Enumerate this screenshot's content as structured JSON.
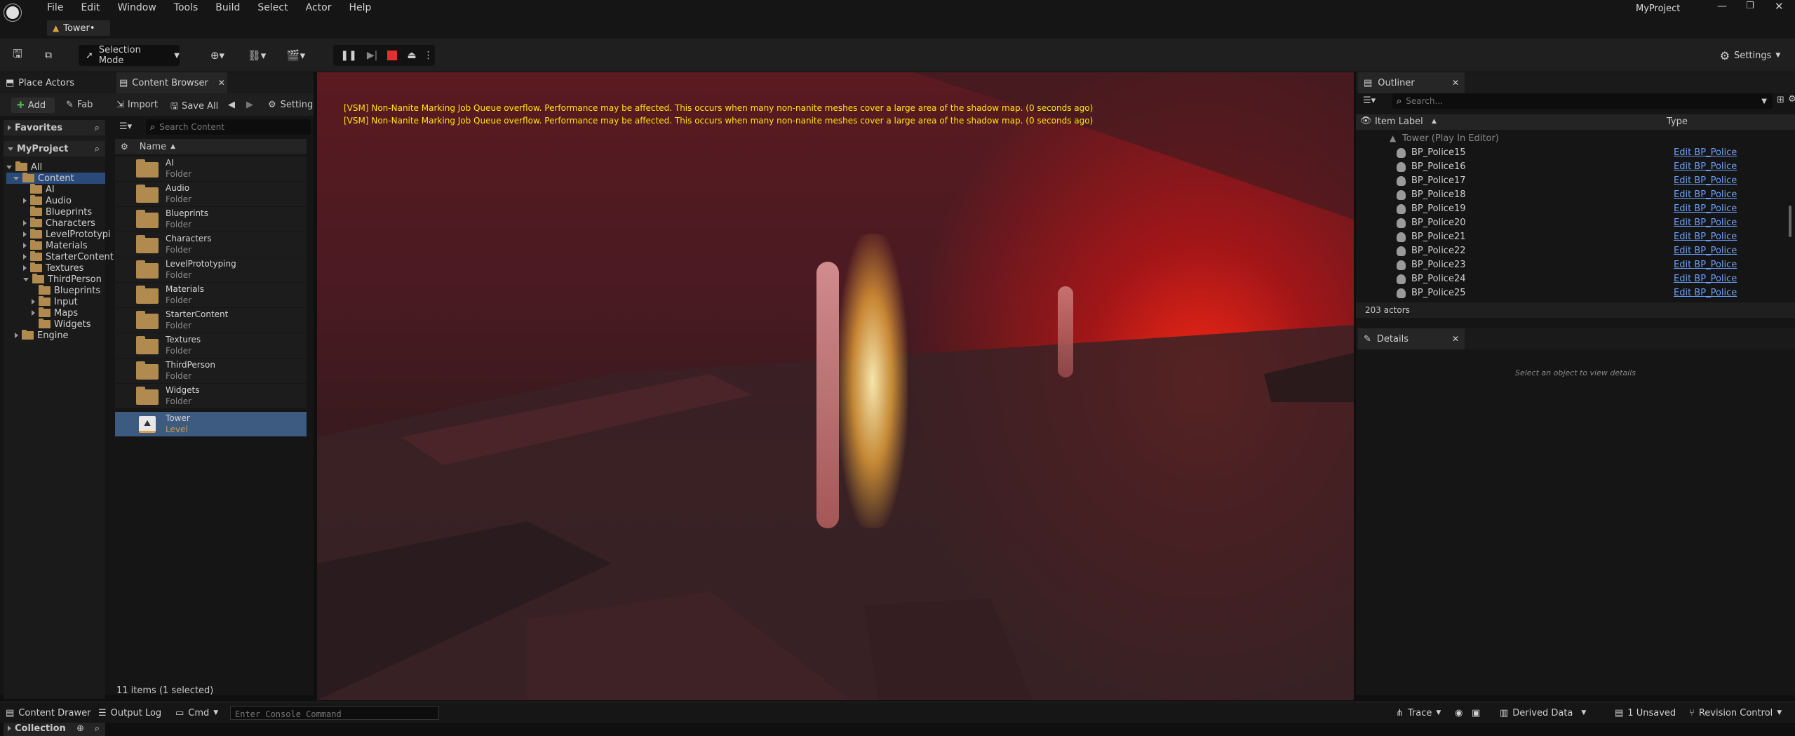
{
  "app": {
    "project": "MyProject",
    "level_tab": "Tower•"
  },
  "menu": [
    "File",
    "Edit",
    "Window",
    "Tools",
    "Build",
    "Select",
    "Actor",
    "Help"
  ],
  "toolbar": {
    "selection_mode": "Selection Mode",
    "settings": "Settings"
  },
  "left_tabs": {
    "place_actors": "Place Actors",
    "content_browser": "Content Browser"
  },
  "content_toolbar": {
    "add": "Add",
    "fab": "Fab",
    "import": "Import",
    "save_all": "Save All",
    "settings": "Setting"
  },
  "sources": {
    "favorites": "Favorites",
    "project": "MyProject",
    "tree": [
      "All",
      "Content",
      "AI",
      "Audio",
      "Blueprints",
      "Characters",
      "LevelPrototypi",
      "Materials",
      "StarterContent",
      "Textures",
      "ThirdPerson",
      "Blueprints",
      "Input",
      "Maps",
      "Widgets",
      "Engine"
    ],
    "collections": "Collection"
  },
  "search": {
    "placeholder": "Search Content"
  },
  "assets": {
    "header": "Name",
    "items": [
      {
        "name": "AI",
        "type": "Folder"
      },
      {
        "name": "Audio",
        "type": "Folder"
      },
      {
        "name": "Blueprints",
        "type": "Folder"
      },
      {
        "name": "Characters",
        "type": "Folder"
      },
      {
        "name": "LevelPrototyping",
        "type": "Folder"
      },
      {
        "name": "Materials",
        "type": "Folder"
      },
      {
        "name": "StarterContent",
        "type": "Folder"
      },
      {
        "name": "Textures",
        "type": "Folder"
      },
      {
        "name": "ThirdPerson",
        "type": "Folder"
      },
      {
        "name": "Widgets",
        "type": "Folder"
      },
      {
        "name": "Tower",
        "type": "Level"
      }
    ],
    "count": "11 items (1 selected)"
  },
  "viewport": {
    "warnings": [
      "[VSM] Non-Nanite Marking Job Queue overflow. Performance may be affected. This occurs when many non-nanite meshes cover a large area of the shadow map. (0 seconds ago)",
      "[VSM] Non-Nanite Marking Job Queue overflow. Performance may be affected. This occurs when many non-nanite meshes cover a large area of the shadow map. (0 seconds ago)"
    ]
  },
  "outliner": {
    "title": "Outliner",
    "search_placeholder": "Search...",
    "col_label": "Item Label",
    "col_type": "Type",
    "root": "Tower (Play In Editor)",
    "rows": [
      {
        "label": "BP_Police15",
        "type": "Edit BP_Police"
      },
      {
        "label": "BP_Police16",
        "type": "Edit BP_Police"
      },
      {
        "label": "BP_Police17",
        "type": "Edit BP_Police"
      },
      {
        "label": "BP_Police18",
        "type": "Edit BP_Police"
      },
      {
        "label": "BP_Police19",
        "type": "Edit BP_Police"
      },
      {
        "label": "BP_Police20",
        "type": "Edit BP_Police"
      },
      {
        "label": "BP_Police21",
        "type": "Edit BP_Police"
      },
      {
        "label": "BP_Police22",
        "type": "Edit BP_Police"
      },
      {
        "label": "BP_Police23",
        "type": "Edit BP_Police"
      },
      {
        "label": "BP_Police24",
        "type": "Edit BP_Police"
      },
      {
        "label": "BP_Police25",
        "type": "Edit BP_Police"
      }
    ],
    "count": "203 actors"
  },
  "details": {
    "title": "Details",
    "empty": "Select an object to view details"
  },
  "status": {
    "content_drawer": "Content Drawer",
    "output_log": "Output Log",
    "cmd": "Cmd",
    "console_placeholder": "Enter Console Command",
    "trace": "Trace",
    "derived_data": "Derived Data",
    "unsaved": "1 Unsaved",
    "revision": "Revision Control"
  }
}
